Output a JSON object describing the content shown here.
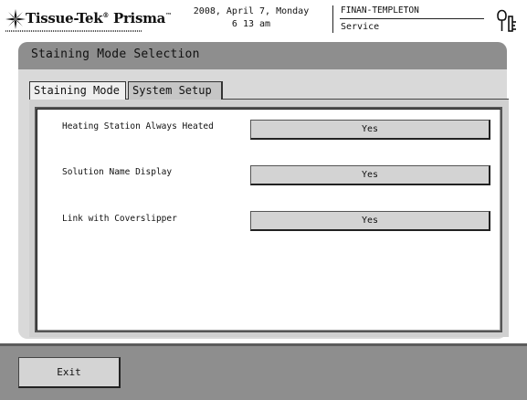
{
  "header": {
    "brand_name": "Tissue-Tek",
    "brand_product": "Prisma",
    "date_line": "2008, April 7, Monday",
    "time_line": "6 13 am",
    "user_name": "FINAN-TEMPLETON",
    "user_role": "Service"
  },
  "window": {
    "title": "Staining Mode Selection",
    "tabs": [
      {
        "label": "Staining Mode",
        "active": false
      },
      {
        "label": "System Setup",
        "active": true
      }
    ]
  },
  "settings": [
    {
      "label": "Heating Station Always Heated",
      "value": "Yes"
    },
    {
      "label": "Solution Name Display",
      "value": "Yes"
    },
    {
      "label": "Link with Coverslipper",
      "value": "Yes"
    }
  ],
  "footer": {
    "exit_label": "Exit"
  },
  "colors": {
    "titlebar": "#8e8e8e",
    "button_face": "#d3d3d3",
    "panel_border": "#555555"
  }
}
